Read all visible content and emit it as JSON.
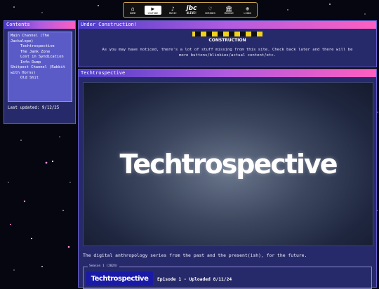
{
  "nav": {
    "items": [
      {
        "label": "HOME",
        "icon": "home-icon"
      },
      {
        "label": "YOUTUBE",
        "icon": "play-icon",
        "active": true
      },
      {
        "label": "MUSIC",
        "icon": "music-note-icon"
      },
      {
        "logo": "jbc",
        "sub": "ALIVE!"
      },
      {
        "label": "SHRINES",
        "icon": "heart-icon"
      },
      {
        "label": "MUSEUM",
        "icon": "museum-icon"
      },
      {
        "label": "LINKS",
        "icon": "globe-icon"
      }
    ]
  },
  "sidebar": {
    "title": "Contents",
    "items": [
      {
        "label": "Main Channel (The Jackalope)",
        "level": 0
      },
      {
        "label": "Techtrospective",
        "level": 1
      },
      {
        "label": "The Jank Zone",
        "level": 1
      },
      {
        "label": "Lost in Syndication",
        "level": 1
      },
      {
        "label": "Info Dump",
        "level": 1
      },
      {
        "label": "Shitpost Channel (Rabbit with Horns)",
        "level": 0
      },
      {
        "label": "Old Shit",
        "level": 1
      }
    ],
    "updated": "Last updated: 9/12/25"
  },
  "construction": {
    "title": "Under Construction!",
    "banner_text": "CONSTRUCTION",
    "message": "As you may have noticed, there's a lot of stuff missing from this site. Check back later and there will be more buttons/blinkies/actual content/etc."
  },
  "techtro": {
    "title": "Techtrospective",
    "hero_title": "Techtrospective",
    "description": "The digital anthropology series from the past and the present(ish), for the future.",
    "season_label": "Season 1 (2024)",
    "thumb_title": "Techtrospective",
    "episode": "Episode 1 - Uploaded 8/11/24"
  }
}
